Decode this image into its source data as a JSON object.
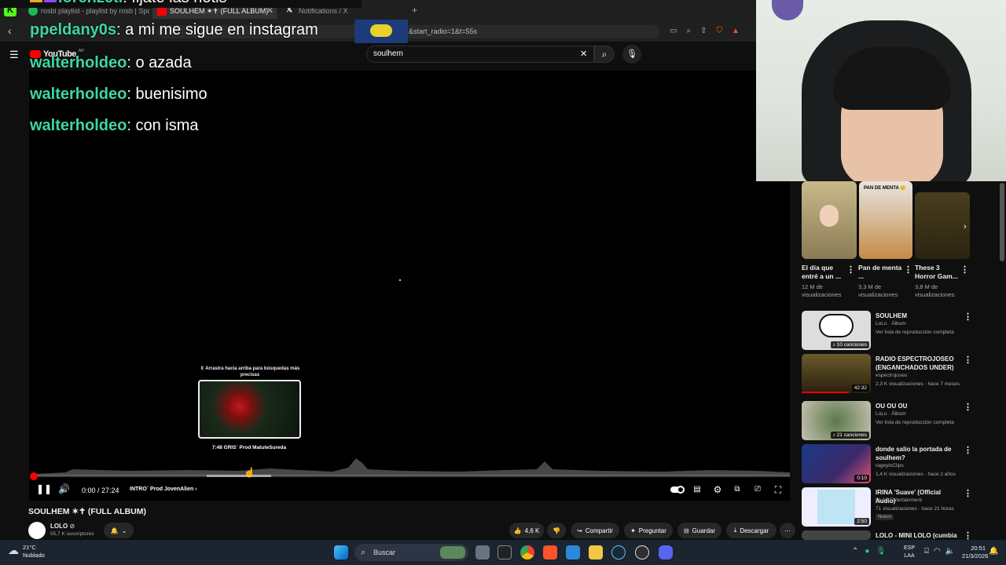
{
  "browser": {
    "tabs": [
      {
        "label": "rosbi playlist - playlist by rosb | Spoti"
      },
      {
        "label": "SOULHEM ✶✝ (FULL ALBUM) - "
      },
      {
        "label": "Notifications / X"
      }
    ],
    "new_tab": "+",
    "url_fragment": "&start_radio=1&t=55s"
  },
  "youtube": {
    "logo": "YouTube",
    "country": "AR",
    "search_value": "soulhem"
  },
  "chat": [
    {
      "user": "lorenzeti",
      "msg": ": fijate las notis"
    },
    {
      "user": "ppeldany0s",
      "msg": ": a mi me sigue en instagram"
    },
    {
      "user": "walterholdeo",
      "msg": ": o azada"
    },
    {
      "user": "walterholdeo",
      "msg": ": buenisimo"
    },
    {
      "user": "walterholdeo",
      "msg": ": con isma"
    }
  ],
  "player": {
    "drag_hint": "⇳ Arrastra hacia arriba para búsquedas más precisas",
    "preview_caption": "7:48  GRIS¨ Prod MatuteSureda",
    "time": "0:00 / 27:24",
    "chapter": "INTRO¨ Prod JovenAlien",
    "progress": 0.0
  },
  "video": {
    "title": "SOULHEM ✶✝ (FULL ALBUM)",
    "channel": "LOLO",
    "subscribers": "55,7 K suscriptores",
    "likes": "4,6 K",
    "share": "Compartir",
    "ask": "Preguntar",
    "save": "Guardar",
    "download": "Descargar"
  },
  "shorts": [
    {
      "title": "El día que entré a un ...",
      "views": "12 M de visualizaciones"
    },
    {
      "title": "Pan de menta ...",
      "views": "3,3 M de visualizaciones",
      "overlay": "PAN DE MENTA 😊"
    },
    {
      "title": "These 3 Horror Gam...",
      "views": "3,8 M de visualizaciones"
    }
  ],
  "related": [
    {
      "title": "SOULHEM",
      "line1": "LoLo · Álbum",
      "line2": "Ver lista de reproducción completa",
      "badge": "♪ 10 canciones"
    },
    {
      "title": "RADIO ESPECTROJOSEO (ENGANCHADOS UNDER)",
      "line1": "espectrojoseo",
      "line2": "2,3 K visualizaciones · hace 7 meses",
      "badge": "42:32"
    },
    {
      "title": "OU OU OU",
      "line1": "LoLo · Álbum",
      "line2": "Ver lista de reproducción completa",
      "badge": "♪ 21 canciones"
    },
    {
      "title": "donde salio la portada de soulhem?",
      "line1": "rageyloClips",
      "line2": "1,4 K visualizaciones · hace 2 años",
      "badge": "0:10"
    },
    {
      "title": "IRINA 'Suave' (Official Audio)",
      "line1": "BLAX Entertainment",
      "line2": "71 visualizaciones · hace 21 horas",
      "tag": "Nuevo",
      "badge": "2:50"
    },
    {
      "title": "LOLO - MINI LOLO (cumbia"
    }
  ],
  "taskbar": {
    "weather_temp": "21°C",
    "weather_desc": "Nublado",
    "search": "Buscar",
    "lang1": "ESP",
    "lang2": "LAA",
    "time": "20:51",
    "date": "21/3/2026"
  },
  "colors": {
    "chat_user": "#3fd5a3",
    "progress": "#ff0000",
    "taskbar": "#1c2430"
  }
}
